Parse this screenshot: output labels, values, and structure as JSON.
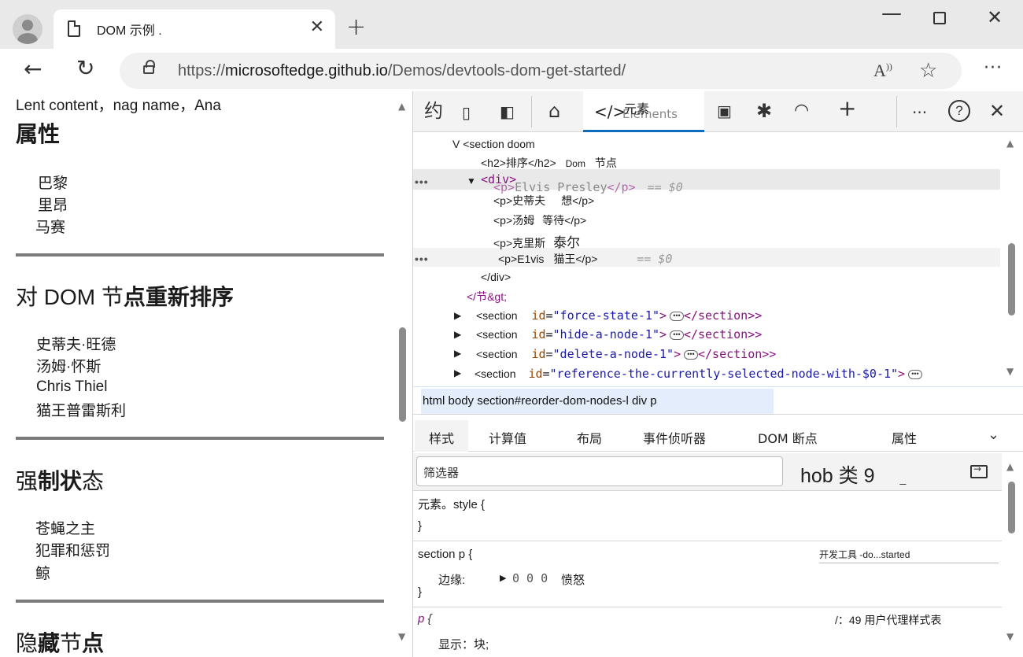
{
  "browser": {
    "tab_title": "DOM 示例 .",
    "url_host_prefix": "https://",
    "url_host": "microsoftedge.github.io",
    "url_path": "/Demos/devtools-dom-get-started/"
  },
  "page": {
    "top_text": "Lent content，nag name，Ana",
    "sections": [
      {
        "heading": "属性",
        "heading_light": "",
        "items": [
          "巴黎",
          "里昂",
          "马赛"
        ]
      },
      {
        "heading_light": "对 DOM 节",
        "heading": "点重新排序",
        "items": [
          "史蒂夫·旺德",
          "汤姆·怀斯",
          "Chris Thiel",
          "猫王普雷斯利"
        ]
      },
      {
        "heading_light": "强",
        "heading": "制状",
        "heading_light2": "态",
        "items": [
          "苍蝇之主",
          "犯罪和惩罚",
          "鲸"
        ]
      },
      {
        "heading_light": "隐",
        "heading": "藏",
        "heading_light2": "节",
        "heading2": "点"
      }
    ]
  },
  "devtools": {
    "toolbar": {
      "left_glyph": "约",
      "elements_label": "元素",
      "elements_ghost": "Elements"
    },
    "dom": {
      "l1": "V <section doom",
      "l2_a": "<h2>排序</h2>",
      "l2_b": "Dom",
      "l2_c": "节点",
      "l3_tag": "<div>",
      "l3_ghost_open": "<p>",
      "l3_ghost_text": "Elvis Presley",
      "l3_ghost_close": "</p>",
      "l3_ref": "== $0",
      "l4_a": "<p>史蒂夫",
      "l4_b": "想</p>",
      "l5_a": "<p>汤姆",
      "l5_b": "等待</p>",
      "l6_a": "<p>克里斯",
      "l6_b": "泰尔",
      "l7_a": "<p>E1vis",
      "l7_b": "猫王</p>",
      "l7_ref": "== $0",
      "l8": "</div>",
      "l9": "</节&gt;",
      "rows": [
        {
          "open": "<section",
          "attr": "id",
          "value": "\"force-state-1\"",
          "close": "</section>"
        },
        {
          "open": "<section",
          "attr": "id",
          "value": "\"hide-a-node-1\"",
          "close": "</section>"
        },
        {
          "open": "<section",
          "attr": "id",
          "value": "\"delete-a-node-1\"",
          "close": "</section>"
        },
        {
          "open": "<section",
          "attr": "id",
          "value": "\"reference-the-currently-selected-node-with-$0-1\"",
          "close": ""
        }
      ]
    },
    "breadcrumb": "html body section#reorder-dom-nodes-l div p",
    "subtabs": [
      "样式",
      "计算值",
      "布局",
      "事件侦听器",
      "DOM 断点",
      "属性"
    ],
    "filter_placeholder": "筛选器",
    "hov_cls": "hob 类 9",
    "hov_cls_extra": "_",
    "styles": {
      "r1_selector": "元素。style {",
      "r1_close": "}",
      "r2_selector": "section p {",
      "r2_source": "开发工具 -do...started",
      "r2_prop": "边缘:",
      "r2_value": "0 0 0",
      "r2_value_tail": "愤怒",
      "r2_close": "}",
      "r3_selector": "p",
      "r3_brace": "{",
      "r3_source": "/：49 用户代理样式表",
      "r3_prop": "显示：块;"
    }
  }
}
